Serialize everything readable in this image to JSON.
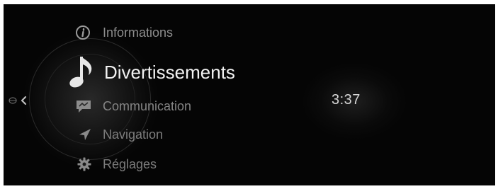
{
  "menu": {
    "items": [
      {
        "label": "Informations",
        "icon": "info-icon",
        "selected": false
      },
      {
        "label": "Divertissements",
        "icon": "music-note-icon",
        "selected": true
      },
      {
        "label": "Communication",
        "icon": "message-icon",
        "selected": false
      },
      {
        "label": "Navigation",
        "icon": "navigation-arrow-icon",
        "selected": false
      },
      {
        "label": "Réglages",
        "icon": "gear-icon",
        "selected": false
      }
    ]
  },
  "status": {
    "clock": "3:37"
  },
  "colors": {
    "background": "#050505",
    "selected_text": "#f2f2f2",
    "unselected_text": "#858585"
  }
}
